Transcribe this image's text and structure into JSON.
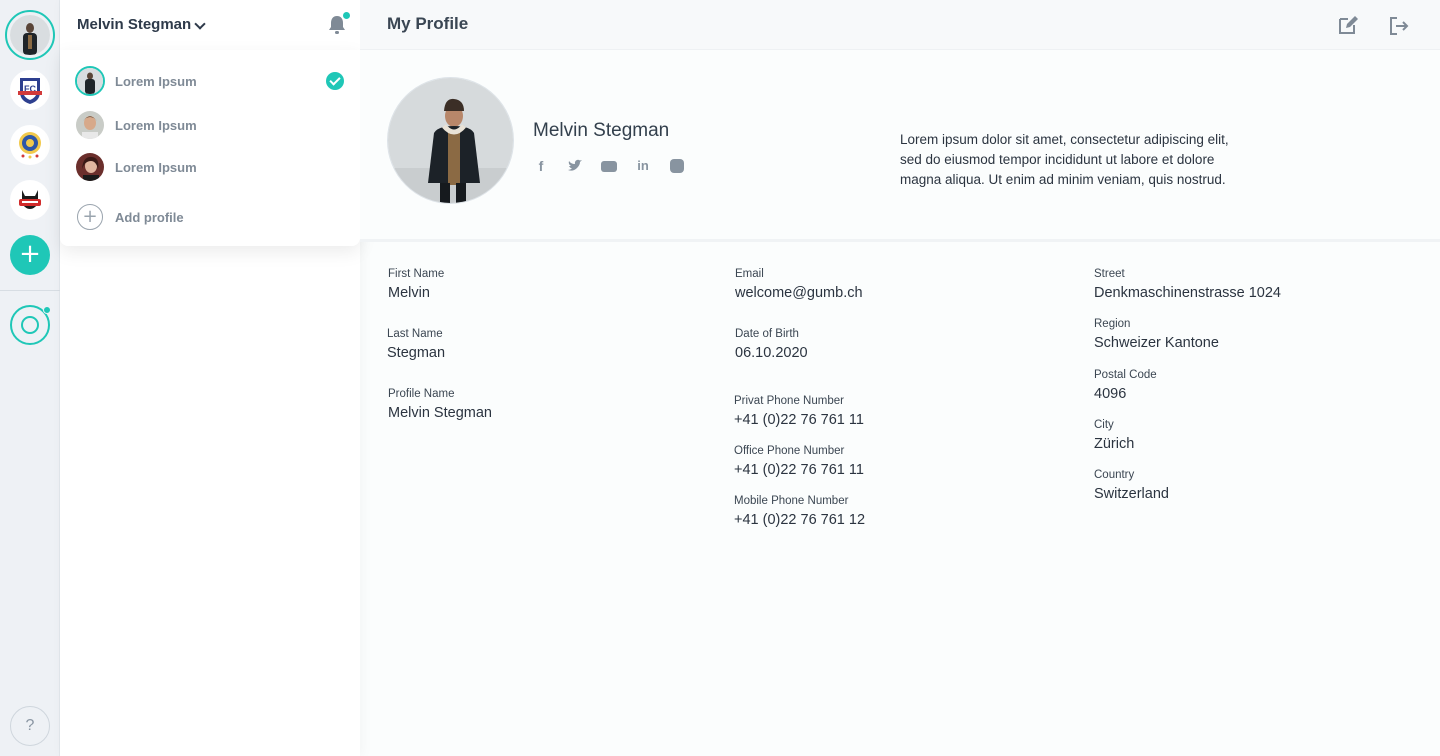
{
  "header": {
    "current_profile": "Melvin Stegman",
    "page_title": "My Profile"
  },
  "profile_menu": {
    "items": [
      {
        "label": "Lorem Ipsum",
        "selected": true
      },
      {
        "label": "Lorem Ipsum",
        "selected": false
      },
      {
        "label": "Lorem Ipsum",
        "selected": false
      }
    ],
    "add_label": "Add profile"
  },
  "rail": {
    "add_symbol": "+",
    "help_symbol": "?"
  },
  "profile": {
    "name": "Melvin Stegman",
    "bio": "Lorem ipsum dolor sit amet, consectetur adipiscing elit, sed do eiusmod tempor incididunt ut labore et dolore magna aliqua. Ut enim ad minim veniam, quis nostrud.",
    "socials": [
      "facebook-icon",
      "twitter-icon",
      "youtube-icon",
      "linkedin-icon",
      "instagram-icon"
    ]
  },
  "fields": {
    "first_name": {
      "label": "First Name",
      "value": "Melvin"
    },
    "last_name": {
      "label": "Last Name",
      "value": "Stegman"
    },
    "profile_name": {
      "label": "Profile Name",
      "value": "Melvin Stegman"
    },
    "email": {
      "label": "Email",
      "value": "welcome@gumb.ch"
    },
    "dob": {
      "label": "Date of Birth",
      "value": "06.10.2020"
    },
    "private_phone": {
      "label": "Privat Phone Number",
      "value": "+41 (0)22 76 761 11"
    },
    "office_phone": {
      "label": "Office Phone Number",
      "value": "+41 (0)22 76 761 11"
    },
    "mobile_phone": {
      "label": "Mobile Phone Number",
      "value": "+41 (0)22 76 761 12"
    },
    "street": {
      "label": "Street",
      "value": "Denkmaschinenstrasse 1024"
    },
    "region": {
      "label": "Region",
      "value": "Schweizer Kantone"
    },
    "postal_code": {
      "label": "Postal Code",
      "value": "4096"
    },
    "city": {
      "label": "City",
      "value": "Zürich"
    },
    "country": {
      "label": "Country",
      "value": "Switzerland"
    }
  },
  "colors": {
    "accent": "#1fc7b7",
    "text": "#2b3440",
    "muted": "#7f8a96"
  }
}
